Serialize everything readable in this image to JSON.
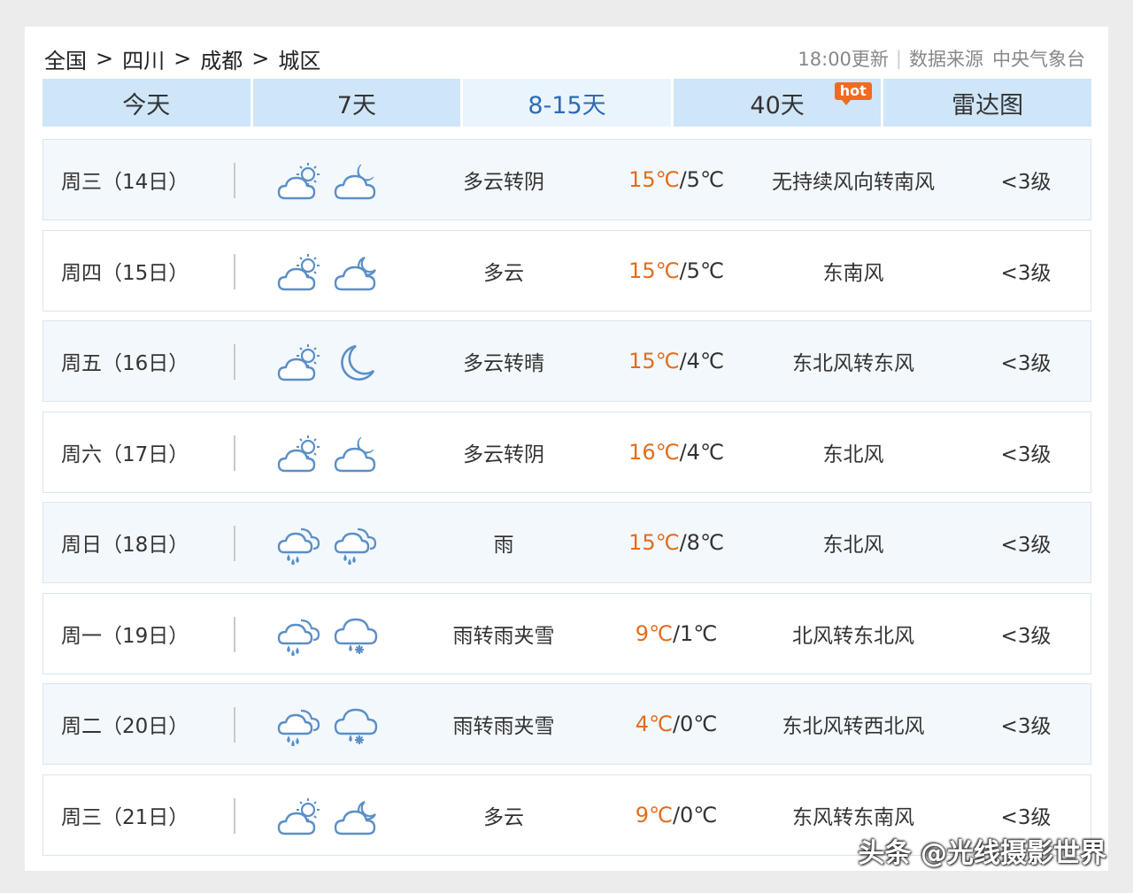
{
  "breadcrumb": [
    "全国",
    "四川",
    "成都",
    "城区"
  ],
  "breadcrumb_separator": ">",
  "update_time": "18:00更新",
  "meta_divider": "|",
  "source_label": "数据来源",
  "source_name": "中央气象台",
  "tabs": [
    {
      "label": "今天"
    },
    {
      "label": "7天"
    },
    {
      "label": "8-15天",
      "active": true
    },
    {
      "label": "40天",
      "badge": "hot"
    },
    {
      "label": "雷达图"
    }
  ],
  "rows": [
    {
      "day": "周三（14日）",
      "icon_day": "partly-cloudy-day-icon",
      "icon_night": "cloudy-night-icon",
      "desc": "多云转阴",
      "high": "15℃",
      "low": "/5℃",
      "wind": "无持续风向转南风",
      "level": "<3级"
    },
    {
      "day": "周四（15日）",
      "icon_day": "partly-cloudy-day-icon",
      "icon_night": "partly-cloudy-night-icon",
      "desc": "多云",
      "high": "15℃",
      "low": "/5℃",
      "wind": "东南风",
      "level": "<3级"
    },
    {
      "day": "周五（16日）",
      "icon_day": "partly-cloudy-day-icon",
      "icon_night": "clear-night-icon",
      "desc": "多云转晴",
      "high": "15℃",
      "low": "/4℃",
      "wind": "东北风转东风",
      "level": "<3级"
    },
    {
      "day": "周六（17日）",
      "icon_day": "partly-cloudy-day-icon",
      "icon_night": "cloudy-night-icon",
      "desc": "多云转阴",
      "high": "16℃",
      "low": "/4℃",
      "wind": "东北风",
      "level": "<3级"
    },
    {
      "day": "周日（18日）",
      "icon_day": "rain-icon",
      "icon_night": "rain-icon",
      "desc": "雨",
      "high": "15℃",
      "low": "/8℃",
      "wind": "东北风",
      "level": "<3级"
    },
    {
      "day": "周一（19日）",
      "icon_day": "rain-icon",
      "icon_night": "sleet-icon",
      "desc": "雨转雨夹雪",
      "high": "9℃",
      "low": "/1℃",
      "wind": "北风转东北风",
      "level": "<3级"
    },
    {
      "day": "周二（20日）",
      "icon_day": "rain-icon",
      "icon_night": "sleet-icon",
      "desc": "雨转雨夹雪",
      "high": "4℃",
      "low": "/0℃",
      "wind": "东北风转西北风",
      "level": "<3级"
    },
    {
      "day": "周三（21日）",
      "icon_day": "partly-cloudy-day-icon",
      "icon_night": "partly-cloudy-night-icon",
      "desc": "多云",
      "high": "9℃",
      "low": "/0℃",
      "wind": "东风转东南风",
      "level": "<3级"
    }
  ],
  "watermark": "头条 @光线摄影世界",
  "colors": {
    "tab_bg": "#cfe5f8",
    "tab_active_bg": "#eaf4fd",
    "tab_active_text": "#2d6bb5",
    "high_temp": "#e26d1c",
    "icon_stroke": "#5b8fc7",
    "hot_badge": "#f26a1f"
  }
}
